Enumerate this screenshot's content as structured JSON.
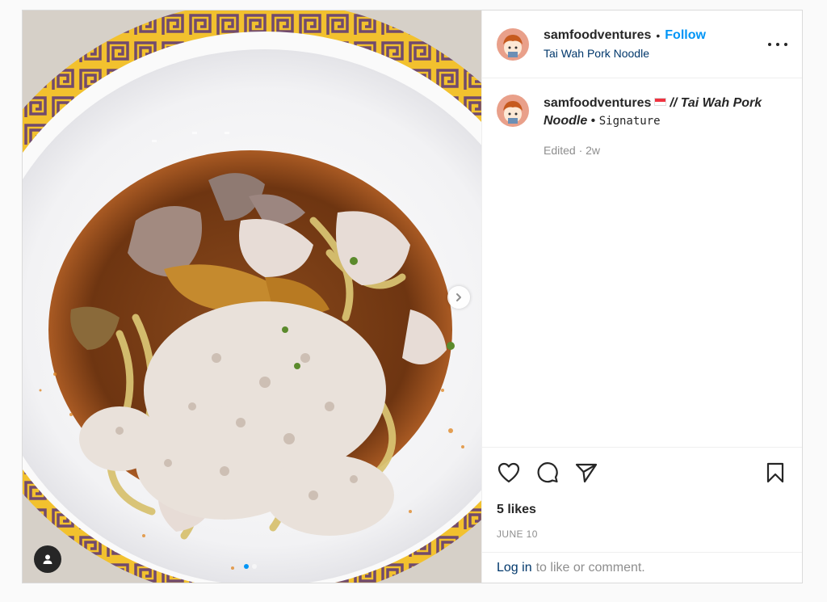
{
  "post": {
    "username": "samfoodventures",
    "separator": "•",
    "follow_label": "Follow",
    "location": "Tai Wah Pork Noodle",
    "caption": {
      "username": "samfoodventures",
      "flag": "singapore-flag",
      "bold_text": "// Tai Wah Pork Noodle",
      "separator": " • ",
      "mono_text": "Signature"
    },
    "meta": "Edited · 2w",
    "likes": "5 likes",
    "date": "JUNE 10",
    "login_link": "Log in",
    "login_text": "to like or comment.",
    "carousel": {
      "total": 2,
      "active": 1
    },
    "icons": [
      "heart-icon",
      "comment-icon",
      "share-icon",
      "bookmark-icon",
      "more-icon",
      "next-arrow-icon",
      "user-tag-icon"
    ]
  },
  "colors": {
    "accent": "#0095f6",
    "link": "#00376b",
    "muted": "#8e8e8e",
    "text": "#262626",
    "border": "#dbdbdb"
  }
}
